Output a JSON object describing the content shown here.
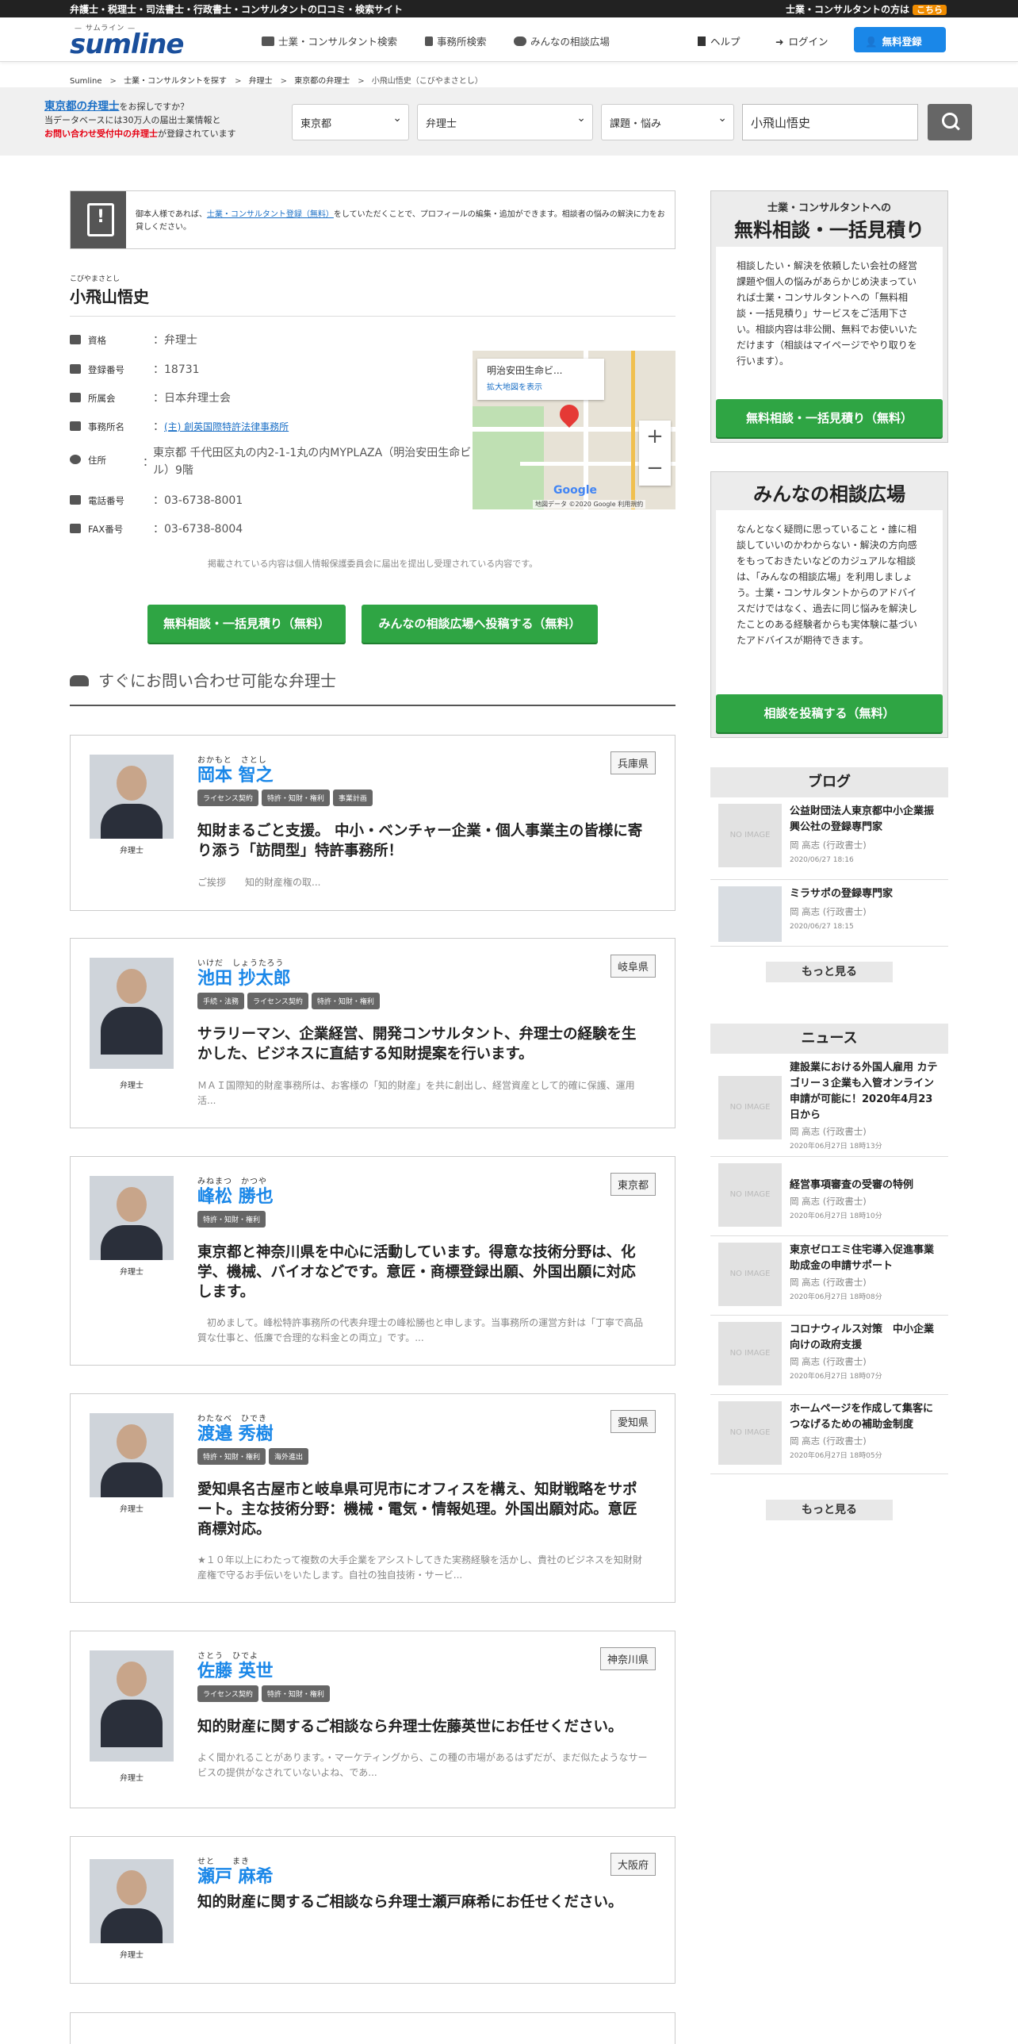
{
  "topbar": {
    "left": "弁護士・税理士・司法書士・行政書士・コンサルタントの口コミ・検索サイト",
    "right": "士業・コンサルタントの方は",
    "badge": "こちら"
  },
  "header": {
    "logo_tag": "— サムライン —",
    "logo": "sumline",
    "nav": [
      "士業・コンサルタント検索",
      "事務所検索",
      "みんなの相談広場"
    ],
    "help": "ヘルプ",
    "login": "ログイン",
    "register": "無料登録"
  },
  "breadcrumb": [
    "Sumline",
    "士業・コンサルタントを探す",
    "弁理士",
    "東京都の弁理士",
    "小飛山悟史（こびやまさとし）"
  ],
  "searchband": {
    "line1_link": "東京都の弁理士",
    "line1_rest": "をお探しですか？",
    "line2": "当データベースには30万人の届出士業情報と",
    "line3_red": "お問い合わせ受付中の弁理士",
    "line3_rest": "が登録されています",
    "pref": "東京都",
    "job": "弁理士",
    "topic": "課題・悩み",
    "query": "小飛山悟史"
  },
  "notice": {
    "pre": "御本人様であれば、",
    "link": "士業・コンサルタント登録（無料）",
    "post": "をしていただくことで、プロフィールの編集・追加ができます。相談者の悩みの解決に力をお貸しください。"
  },
  "profile": {
    "ruby": "こびやまさとし",
    "name": "小飛山悟史",
    "rows": [
      {
        "label": "資格",
        "value": "：弁理士"
      },
      {
        "label": "登録番号",
        "value": "：18731"
      },
      {
        "label": "所属会",
        "value": "：日本弁理士会"
      },
      {
        "label": "事務所名",
        "value": "(主) 創英国際特許法律事務所"
      },
      {
        "label": "住所",
        "value": "東京都 千代田区丸の内2-1-1丸の内MYPLAZA（明治安田生命ビル）9階"
      },
      {
        "label": "電話番号",
        "value": "：03-6738-8001"
      },
      {
        "label": "FAX番号",
        "value": "：03-6738-8004"
      }
    ],
    "map": {
      "popup": "明治安田生命ビ...",
      "enlarge": "拡大地図を表示",
      "google": "Google",
      "copy": "地図データ ©2020 Google  利用規約"
    }
  },
  "note": "掲載されている内容は個人情報保護委員会に届出を提出し受理されている内容です。",
  "cta": {
    "estimate": "無料相談・一括見積り（無料）",
    "forum": "みんなの相談広場へ投稿する（無料）"
  },
  "section_title": "すぐにお問い合わせ可能な弁理士",
  "cards": [
    {
      "ruby": "おかもと　さとし",
      "name": "岡本 智之",
      "pref": "兵庫県",
      "tags": [
        "ライセンス契約",
        "特許・知財・権利",
        "事業計画"
      ],
      "head": "知財まるごと支援。 中小・ベンチャー企業・個人事業主の皆様に寄り添う「訪問型」特許事務所！",
      "desc": "ご挨拶　　知的財産権の取...",
      "label": "弁理士"
    },
    {
      "ruby": "いけだ　しょうたろう",
      "name": "池田 抄太郎",
      "pref": "岐阜県",
      "tags": [
        "手続・法務",
        "ライセンス契約",
        "特許・知財・権利"
      ],
      "head": "サラリーマン、企業経営、開発コンサルタント、弁理士の経験を生かした、ビジネスに直結する知財提案を行います。",
      "desc": "ＭＡＩ国際知的財産事務所は、お客様の「知的財産」を共に創出し、経営資産として的確に保護、運用活...",
      "label": "弁理士"
    },
    {
      "ruby": "みねまつ　かつや",
      "name": "峰松 勝也",
      "pref": "東京都",
      "tags": [
        "特許・知財・権利"
      ],
      "head": "東京都と神奈川県を中心に活動しています。得意な技術分野は、化学、機械、バイオなどです。意匠・商標登録出願、外国出願に対応します。",
      "desc": "　初めまして。峰松特許事務所の代表弁理士の峰松勝也と申します。当事務所の運営方針は「丁寧で高品質な仕事と、低廉で合理的な料金との両立」です。...",
      "label": "弁理士"
    },
    {
      "ruby": "わたなべ　ひでき",
      "name": "渡邉 秀樹",
      "pref": "愛知県",
      "tags": [
        "特許・知財・権利",
        "海外進出"
      ],
      "head": "愛知県名古屋市と岐阜県可児市にオフィスを構え、知財戦略をサポート。主な技術分野：機械・電気・情報処理。外国出願対応。意匠商標対応。",
      "desc": "★１０年以上にわたって複数の大手企業をアシストしてきた実務経験を活かし、貴社のビジネスを知財財産権で守るお手伝いをいたします。自社の独自技術・サービ...",
      "label": "弁理士"
    },
    {
      "ruby": "さとう　ひでよ",
      "name": "佐藤 英世",
      "pref": "神奈川県",
      "tags": [
        "ライセンス契約",
        "特許・知財・権利"
      ],
      "head": "知的財産に関するご相談なら弁理士佐藤英世にお任せください。",
      "desc": "よく聞かれることがあります。・マーケティングから、この種の市場があるはずだが、まだ似たようなサービスの提供がなされていないよね、であ...",
      "label": "弁理士"
    },
    {
      "ruby": "せと　　まき",
      "name": "瀬戸 麻希",
      "pref": "大阪府",
      "tags": [],
      "head": "知的財産に関するご相談なら弁理士瀬戸麻希にお任せください。",
      "desc": "",
      "label": "弁理士"
    }
  ],
  "sidebar": {
    "box1": {
      "t1": "士業・コンサルタントへの",
      "t2": "無料相談・一括見積り",
      "body": "相談したい・解決を依頼したい会社の経営課題や個人の悩みがあらかじめ決まっていれば士業・コンサルタントへの「無料相談・一括見積り」サービスをご活用下さい。相談内容は非公開、無料でお使いいただけます（相談はマイページでやり取りを行います）。",
      "btn": "無料相談・一括見積り（無料）"
    },
    "box2": {
      "t2": "みんなの相談広場",
      "body": "なんとなく疑問に思っていること・誰に相談していいのかわからない・解決の方向感をもっておきたいなどのカジュアルな相談は、「みんなの相談広場」を利用しましょう。士業・コンサルタントからのアドバイスだけではなく、過去に同じ悩みを解決したことのある経験者からも実体験に基づいたアドバイスが期待できます。",
      "btn": "相談を投稿する（無料）"
    },
    "blog_title": "ブログ",
    "blog": [
      {
        "title": "公益財団法人東京都中小企業振興公社の登録専門家",
        "author": "岡 高志 (行政書士)",
        "date": "2020/06/27 18:16",
        "thumb": "NO IMAGE"
      },
      {
        "title": "ミラサポの登録専門家",
        "author": "岡 高志 (行政書士)",
        "date": "2020/06/27 18:15",
        "thumb": ""
      }
    ],
    "more": "もっと見る",
    "news_title": "ニュース",
    "news": [
      {
        "title": "建設業における外国人雇用 カテゴリー３企業も入管オンライン申請が可能に！2020年4月23日から",
        "author": "岡 高志 (行政書士)",
        "date": "2020年06月27日 18時13分",
        "thumb": "NO IMAGE"
      },
      {
        "title": "経営事項審査の受審の特例",
        "author": "岡 高志 (行政書士)",
        "date": "2020年06月27日 18時10分",
        "thumb": "NO IMAGE"
      },
      {
        "title": "東京ゼロエミ住宅導入促進事業　助成金の申請サポート",
        "author": "岡 高志 (行政書士)",
        "date": "2020年06月27日 18時08分",
        "thumb": "NO IMAGE"
      },
      {
        "title": "コロナウィルス対策　中小企業向けの政府支援",
        "author": "岡 高志 (行政書士)",
        "date": "2020年06月27日 18時07分",
        "thumb": "NO IMAGE"
      },
      {
        "title": "ホームページを作成して集客につなげるための補助金制度",
        "author": "岡 高志 (行政書士)",
        "date": "2020年06月27日 18時05分",
        "thumb": "NO IMAGE"
      }
    ]
  }
}
